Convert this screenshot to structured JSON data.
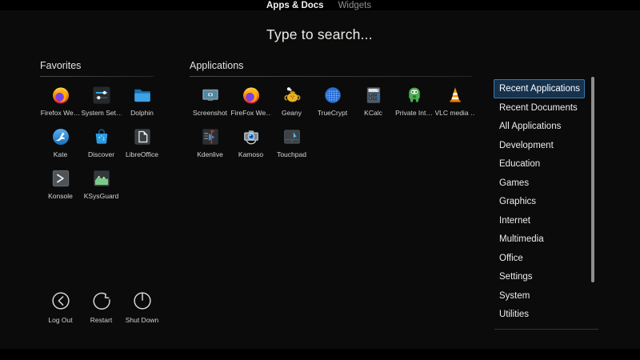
{
  "tabs": {
    "apps_docs": "Apps & Docs",
    "widgets": "Widgets"
  },
  "search": {
    "placeholder": "Type to search..."
  },
  "favorites": {
    "title": "Favorites",
    "apps": [
      {
        "label": "Firefox We…",
        "icon": "firefox-icon"
      },
      {
        "label": "System Set…",
        "icon": "system-settings-icon"
      },
      {
        "label": "Dolphin",
        "icon": "dolphin-icon"
      },
      {
        "label": "Kate",
        "icon": "kate-icon"
      },
      {
        "label": "Discover",
        "icon": "discover-icon"
      },
      {
        "label": "LibreOffice",
        "icon": "libreoffice-icon"
      },
      {
        "label": "Konsole",
        "icon": "konsole-icon"
      },
      {
        "label": "KSysGuard",
        "icon": "ksysguard-icon"
      }
    ]
  },
  "applications": {
    "title": "Applications",
    "apps": [
      {
        "label": "Screenshot",
        "icon": "screenshot-icon"
      },
      {
        "label": "FireFox We…",
        "icon": "firefox-icon"
      },
      {
        "label": "Geany",
        "icon": "geany-icon"
      },
      {
        "label": "TrueCrypt",
        "icon": "truecrypt-icon"
      },
      {
        "label": "KCalc",
        "icon": "kcalc-icon"
      },
      {
        "label": "Private Int…",
        "icon": "pia-icon"
      },
      {
        "label": "VLC media …",
        "icon": "vlc-icon"
      },
      {
        "label": "Kdenlive",
        "icon": "kdenlive-icon"
      },
      {
        "label": "Kamoso",
        "icon": "kamoso-icon"
      },
      {
        "label": "Touchpad",
        "icon": "touchpad-icon"
      }
    ]
  },
  "categories": {
    "items": [
      {
        "label": "Recent Applications",
        "selected": true
      },
      {
        "label": "Recent Documents",
        "selected": false
      },
      {
        "label": "All Applications",
        "selected": false
      },
      {
        "label": "Development",
        "selected": false
      },
      {
        "label": "Education",
        "selected": false
      },
      {
        "label": "Games",
        "selected": false
      },
      {
        "label": "Graphics",
        "selected": false
      },
      {
        "label": "Internet",
        "selected": false
      },
      {
        "label": "Multimedia",
        "selected": false
      },
      {
        "label": "Office",
        "selected": false
      },
      {
        "label": "Settings",
        "selected": false
      },
      {
        "label": "System",
        "selected": false
      },
      {
        "label": "Utilities",
        "selected": false
      }
    ]
  },
  "power": {
    "items": [
      {
        "label": "Log Out",
        "icon": "logout-icon"
      },
      {
        "label": "Restart",
        "icon": "restart-icon"
      },
      {
        "label": "Shut Down",
        "icon": "shutdown-icon"
      }
    ]
  },
  "colors": {
    "accent": "#3daee9",
    "selected_bg": "#16324d",
    "selected_border": "#3a79ab",
    "scrollbar": "#8f8f8f"
  }
}
